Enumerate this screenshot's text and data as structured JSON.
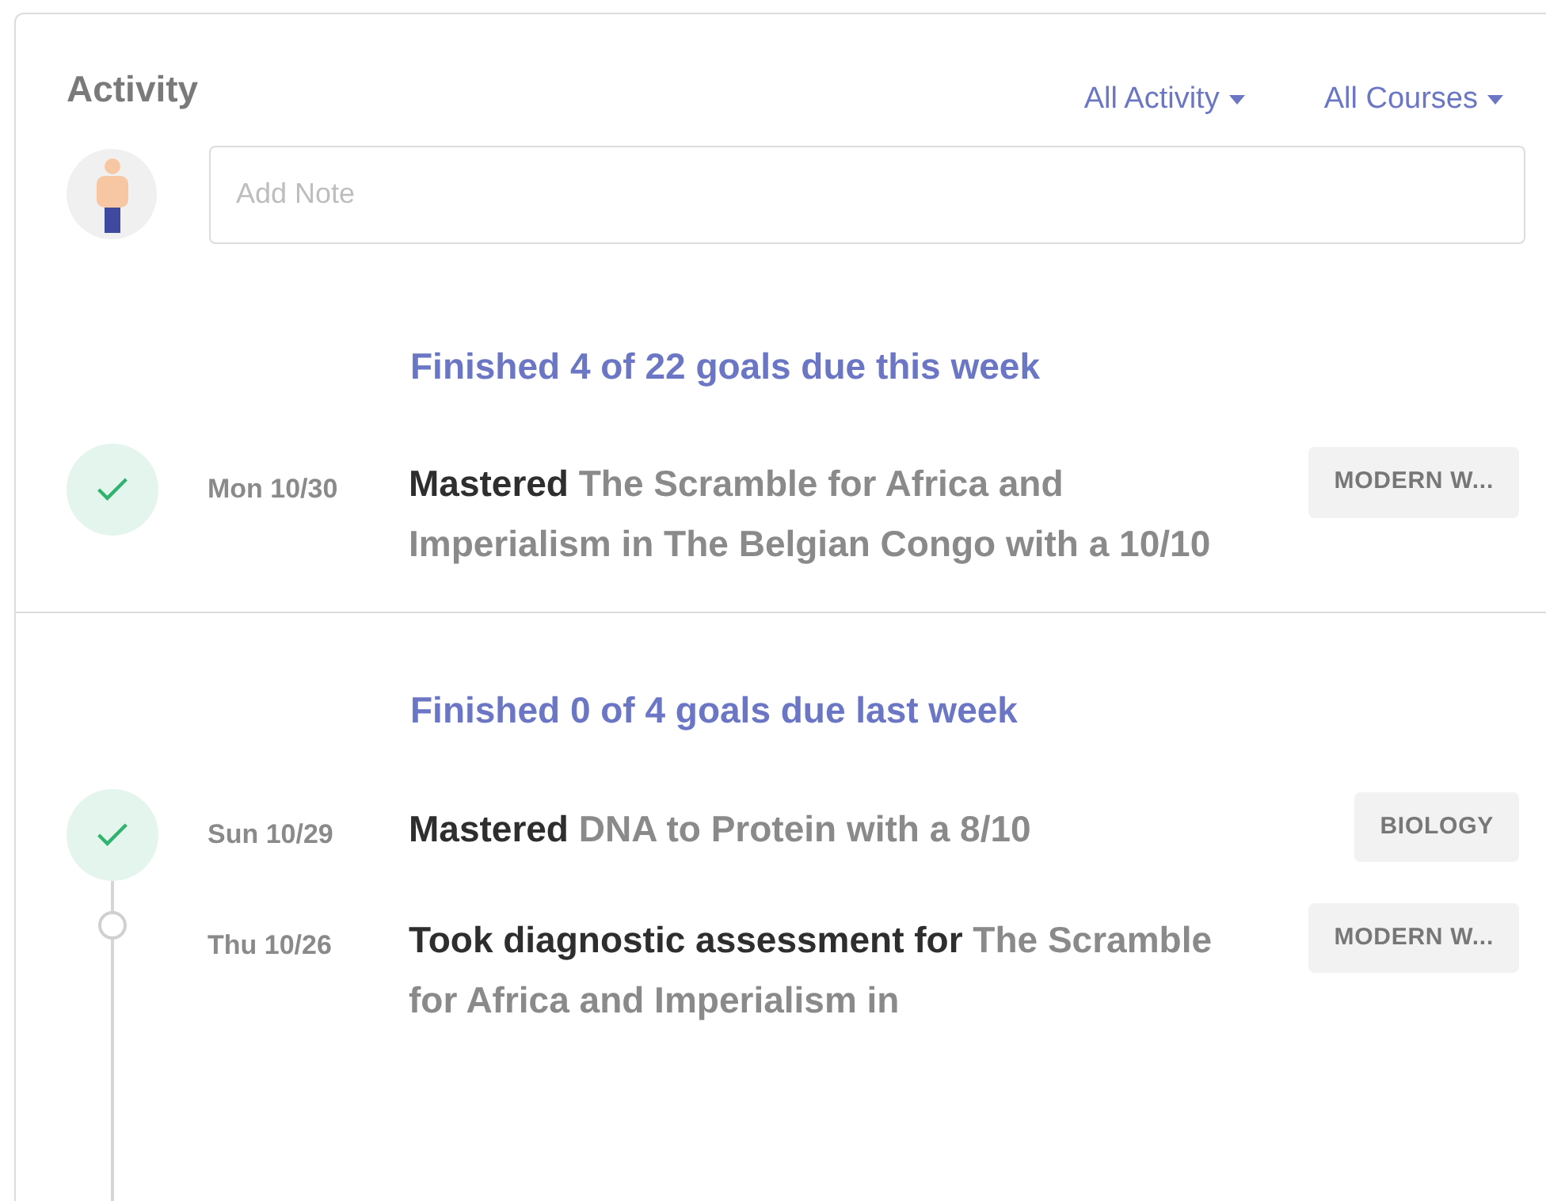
{
  "title": "Activity",
  "filters": [
    "All Activity",
    "All Courses"
  ],
  "note": {
    "placeholder": "Add Note"
  },
  "sections": [
    {
      "heading": "Finished 4 of 22 goals due this week",
      "items": [
        {
          "kind": "check",
          "date": "Mon 10/30",
          "action": "Mastered",
          "subject": "The Scramble for Africa and Imperialism in The Belgian Congo with a 10/10",
          "tag": "MODERN W..."
        }
      ]
    },
    {
      "heading": "Finished 0 of 4 goals due last week",
      "items": [
        {
          "kind": "check",
          "date": "Sun 10/29",
          "action": "Mastered",
          "subject": "DNA to Protein with a 8/10",
          "tag": "BIOLOGY"
        },
        {
          "kind": "dot",
          "date": "Thu 10/26",
          "action": "Took diagnostic assessment for",
          "subject": "The Scramble for Africa and Imperialism in",
          "tag": "MODERN W..."
        }
      ]
    }
  ]
}
